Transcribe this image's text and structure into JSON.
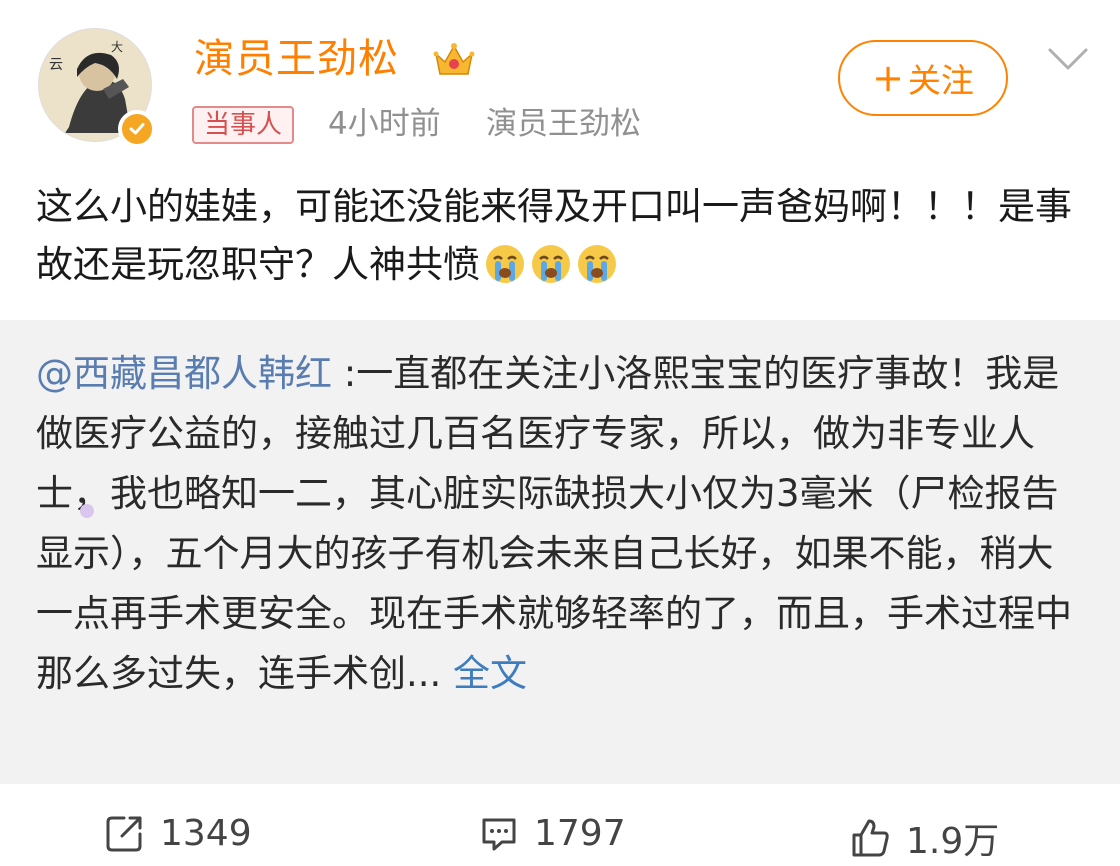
{
  "header": {
    "username": "演员王劲松",
    "tag": "当事人",
    "time": "4小时前",
    "source": "演员王劲松",
    "follow_label": "关注",
    "follow_plus": "+"
  },
  "post": {
    "text": "这么小的娃娃，可能还没能来得及开口叫一声爸妈啊！！！是事故还是玩忽职守？人神共愤"
  },
  "repost": {
    "mention": "@西藏昌都人韩红",
    "text": " :一直都在关注小洛熙宝宝的医疗事故！我是做医疗公益的，接触过几百名医疗专家，所以，做为非专业人士，我也略知一二，其心脏实际缺损大小仅为3毫米（尸检报告显示），五个月大的孩子有机会未来自己长好，如果不能，稍大一点再手术更安全。现在手术就够轻率的了，而且，手术过程中那么多过失，连手术创... ",
    "full_text_label": "全文"
  },
  "actions": {
    "repost_count": "1349",
    "comment_count": "1797",
    "like_count": "1.9万"
  },
  "colors": {
    "brand_orange": "#ff8200",
    "username": "#ff7f00",
    "link_blue": "#3e7cbd",
    "meta_gray": "#909090",
    "repost_bg": "#f2f2f2"
  },
  "icons": [
    "avatar-image",
    "verified-badge-icon",
    "crown-icon",
    "chevron-down-icon",
    "crying-emoji-icon",
    "repost-icon",
    "comment-icon",
    "like-icon"
  ]
}
